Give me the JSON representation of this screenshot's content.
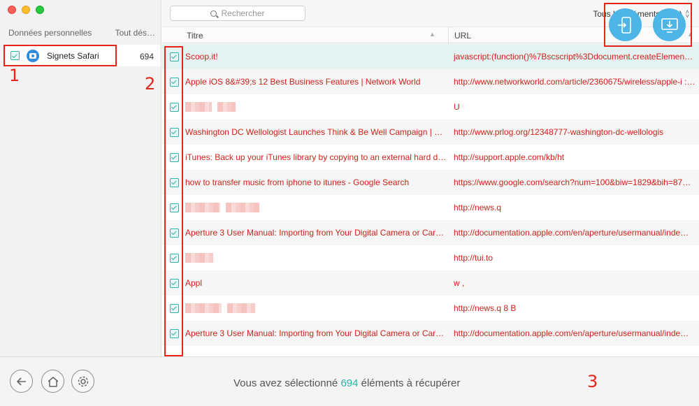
{
  "sidebar": {
    "header_left": "Données personnelles",
    "header_right": "Tout dés…",
    "item": {
      "label": "Signets Safari",
      "count": "694",
      "icon": "safari-icon"
    }
  },
  "toolbar": {
    "search_placeholder": "Rechercher",
    "filter_label": "Tous les éléments (694)"
  },
  "table": {
    "columns": [
      "Titre",
      "URL"
    ],
    "rows": [
      {
        "titre": "Scoop.it!",
        "url": "javascript:(function()%7Bscscript%3Ddocument.createElemen…",
        "redacted": false
      },
      {
        "titre": "Apple iOS 8&#39;s 12 Best Business Features | Network World",
        "url": "http://www.networkworld.com/article/2360675/wireless/apple-i : $!",
        "redacted": false
      },
      {
        "titre": "",
        "url": "U",
        "redacted": true
      },
      {
        "titre": "Washington DC Wellologist Launches Think & Be Well Campaign | PRLog",
        "url": "http://www.prlog.org/12348777-washington-dc-wellologis",
        "redacted": false
      },
      {
        "titre": "iTunes: Back up your iTunes library by copying to an external hard drive",
        "url": "http://support.apple.com/kb/ht",
        "redacted": false
      },
      {
        "titre": "how to transfer music from iphone to itunes - Google Search",
        "url": "https://www.google.com/search?num=100&biw=1829&bih=87…",
        "redacted": false
      },
      {
        "titre": "",
        "url": "http://news.q",
        "redacted": true
      },
      {
        "titre": "Aperture 3 User Manual: Importing from Your Digital Camera or Car…",
        "url": "http://documentation.apple.com/en/aperture/usermanual/inde…",
        "redacted": false
      },
      {
        "titre": "",
        "url": "http://tui.to",
        "redacted": true
      },
      {
        "titre": "Appl",
        "url": "w ,",
        "redacted": false
      },
      {
        "titre": "",
        "url": "http://news.q 8 B",
        "redacted": true
      },
      {
        "titre": "Aperture 3 User Manual: Importing from Your Digital Camera or Car…",
        "url": "http://documentation.apple.com/en/aperture/usermanual/inde…",
        "redacted": false
      }
    ]
  },
  "footer": {
    "status_prefix": "Vous avez sélectionné ",
    "status_count": "694",
    "status_suffix": " éléments à récupérer"
  },
  "annotations": [
    "1",
    "2",
    "3"
  ],
  "colors": {
    "accent": "#2ab5a5",
    "highlight": "#e8231a",
    "action": "#4eb6e6",
    "row_text": "#d0211a"
  }
}
